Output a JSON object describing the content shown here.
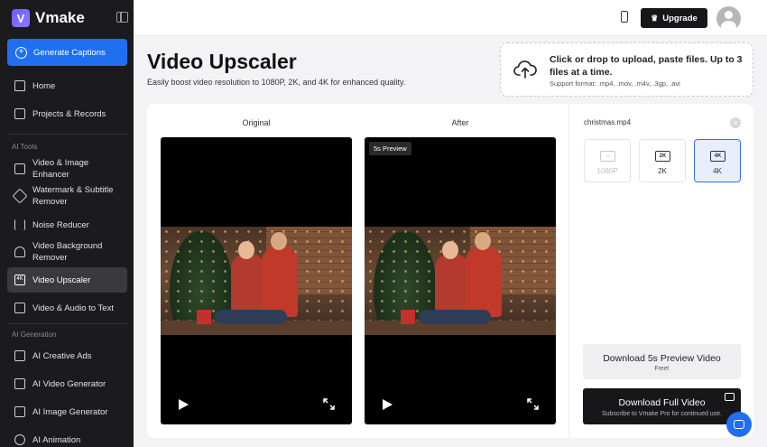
{
  "app": {
    "name": "Vmake",
    "logo_letter": "V"
  },
  "sidebar": {
    "generate_label": "Generate Captions",
    "items_top": [
      {
        "label": "Home"
      },
      {
        "label": "Projects & Records"
      }
    ],
    "section_ai_tools": "AI Tools",
    "ai_tools": [
      {
        "label": "Video & Image Enhancer"
      },
      {
        "label": "Watermark & Subtitle Remover"
      },
      {
        "label": "Noise Reducer"
      },
      {
        "label": "Video Background Remover"
      },
      {
        "label": "Video Upscaler",
        "active": true
      },
      {
        "label": "Video & Audio to Text"
      }
    ],
    "section_ai_generation": "AI Generation",
    "ai_generation": [
      {
        "label": "AI Creative Ads"
      },
      {
        "label": "AI Video Generator"
      },
      {
        "label": "AI Image Generator"
      },
      {
        "label": "AI Animation"
      }
    ]
  },
  "topbar": {
    "upgrade_label": "Upgrade"
  },
  "header": {
    "title": "Video Upscaler",
    "subtitle": "Easily boost video resolution to 1080P, 2K, and 4K for enhanced quality."
  },
  "upload": {
    "main": "Click or drop to upload, paste files. Up to 3 files at a time.",
    "sub": "Support format: .mp4, .mov, .m4v, .3gp, .avi"
  },
  "compare": {
    "original_label": "Original",
    "after_label": "After",
    "preview_badge": "5s Preview"
  },
  "settings": {
    "file_name": "christmas.mp4",
    "options": [
      {
        "badge": "1080P",
        "label": "1080P",
        "state": "disabled"
      },
      {
        "badge": "2K",
        "label": "2K",
        "state": "normal"
      },
      {
        "badge": "4K",
        "label": "4K",
        "state": "selected"
      }
    ],
    "download_preview": {
      "title": "Download 5s Preview Video",
      "sub": "Free!"
    },
    "download_full": {
      "title": "Download Full Video",
      "sub": "Subscribe to Vmake Pro for continued use."
    }
  },
  "colors": {
    "accent": "#1f6ff0",
    "sidebar_bg": "#1b1b1d",
    "selected_bg": "#e8eefc"
  }
}
